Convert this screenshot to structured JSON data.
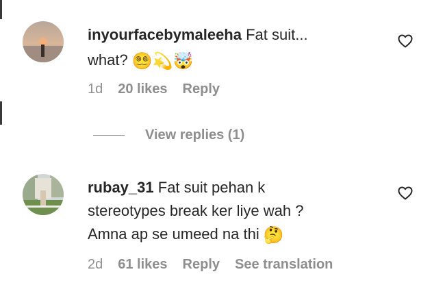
{
  "comments": [
    {
      "username": "inyourfacebymaleeha",
      "text_line1": "Fat suit...",
      "text_line2": "what?",
      "emojis": [
        "😵‍💫",
        "💫",
        "🤯"
      ],
      "emoji_icons": [
        "dizzy-face-icon",
        "dizzy-star-icon",
        "exploding-head-icon"
      ],
      "time": "1d",
      "likes": "20 likes",
      "reply_label": "Reply"
    },
    {
      "username": "rubay_31",
      "text_line1": "Fat suit pehan k",
      "text_line2": "stereotypes break ker liye wah ?",
      "text_line3": "Amna ap se umeed na thi",
      "emojis": [
        "🤔"
      ],
      "emoji_icons": [
        "thinking-face-icon"
      ],
      "time": "2d",
      "likes": "61 likes",
      "reply_label": "Reply",
      "translate_label": "See translation"
    }
  ],
  "view_replies": "View replies (1)",
  "icons": {
    "like": "heart-outline-icon"
  },
  "colors": {
    "text": "#262626",
    "secondary": "#8e8e8e",
    "background": "#ffffff"
  }
}
